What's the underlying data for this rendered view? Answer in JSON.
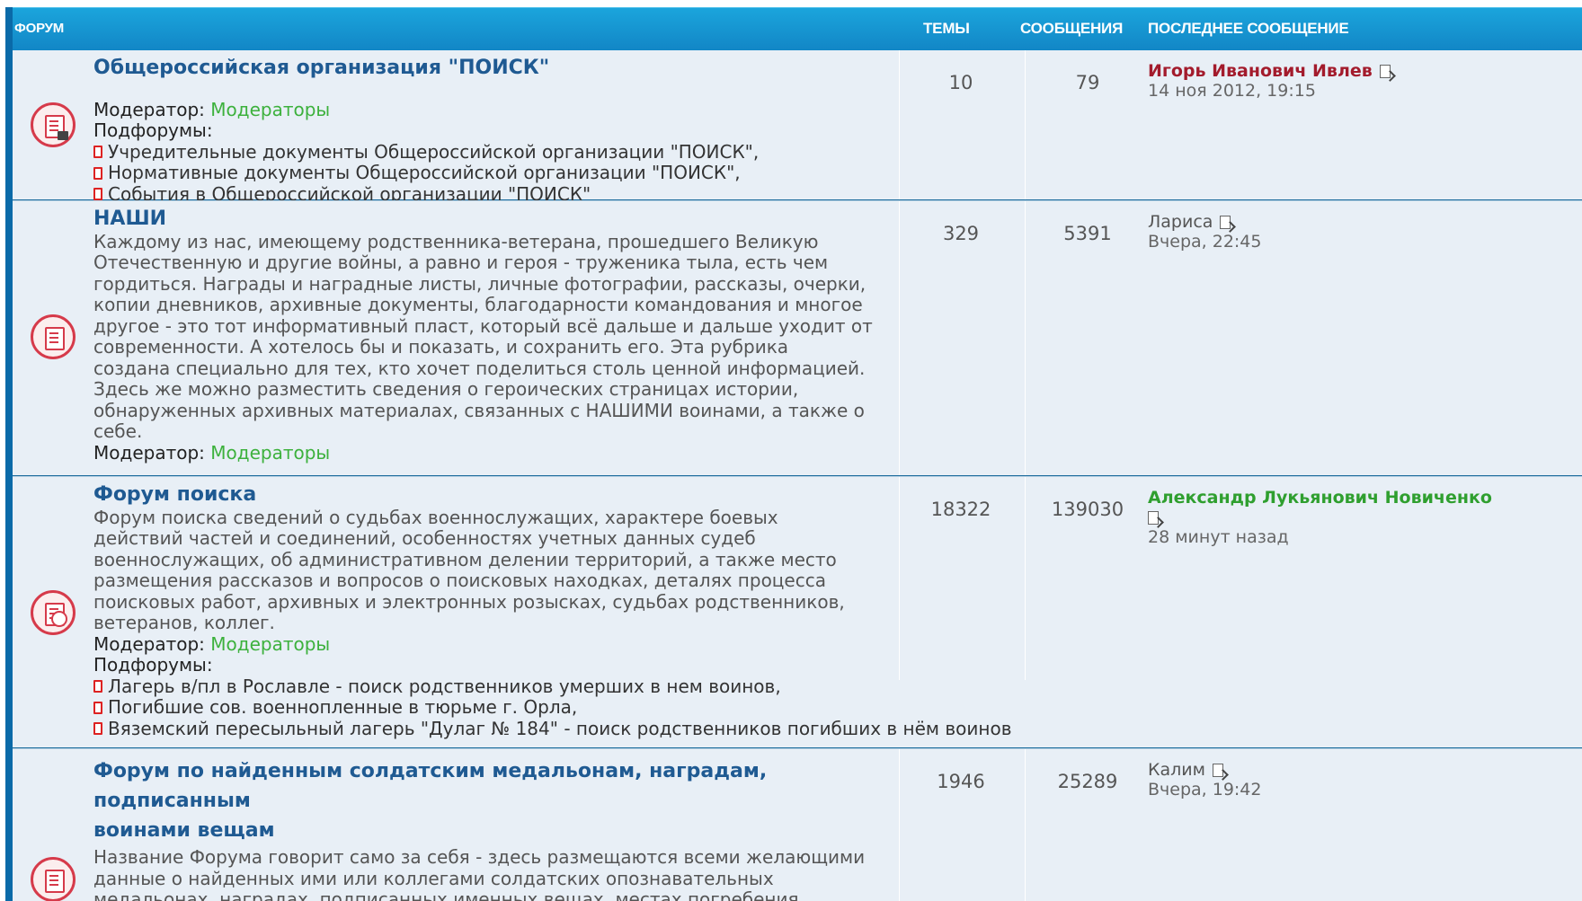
{
  "header": {
    "forum": "ФОРУМ",
    "topics": "ТЕМЫ",
    "posts": "СООБЩЕНИЯ",
    "last_post": "ПОСЛЕДНЕЕ СООБЩЕНИЕ"
  },
  "forums": [
    {
      "title": "Общероссийская организация \"ПОИСК\"",
      "moderator_label": "Модератор:",
      "moderator": "Модераторы",
      "subforums_label": "Подфорумы:",
      "subforums": [
        "Учредительные документы Общероссийской организации \"ПОИСК\",",
        "Нормативные документы Общероссийской организации \"ПОИСК\",",
        "События в Общероссийской организации \"ПОИСК\""
      ],
      "topics": "10",
      "posts": "79",
      "last_user": "Игорь Иванович Ивлев",
      "last_time": "14 ноя 2012, 19:15"
    },
    {
      "title": "НАШИ",
      "desc_lines": [
        "Каждому из нас, имеющему родственника-ветерана, прошедшего Великую",
        "Отечественную и другие войны, а равно и героя - труженика тыла, есть чем",
        "гордиться. Награды и наградные листы, личные фотографии, рассказы, очерки,",
        "копии дневников, архивные документы, благодарности командования и многое",
        "другое - это тот информативный пласт, который всё дальше и дальше уходит от",
        "современности. А хотелось бы и показать, и сохранить его. Эта рубрика",
        "создана специально для тех, кто хочет поделиться столь ценной информацией.",
        "Здесь же можно разместить сведения о героических страницах истории,",
        "обнаруженных архивных материалах, связанных с НАШИМИ воинами, а также о",
        "себе."
      ],
      "moderator_label": "Модератор:",
      "moderator": "Модераторы",
      "topics": "329",
      "posts": "5391",
      "last_user": "Лариса",
      "last_time": "Вчера, 22:45"
    },
    {
      "title": "Форум поиска",
      "desc_lines": [
        "Форум поиска сведений о судьбах военнослужащих, характере боевых",
        "действий частей и соединений, особенностях учетных данных судеб",
        "военнослужащих, об административном делении территорий, а также место",
        "размещения рассказов и вопросов о поисковых находках, деталях процесса",
        "поисковых работ, архивных и электронных розысках, судьбах родственников,",
        "ветеранов, коллег."
      ],
      "moderator_label": "Модератор:",
      "moderator": "Модераторы",
      "subforums_label": "Подфорумы:",
      "subforums": [
        "Лагерь в/пл в Рославле - поиск родственников умерших в нем воинов,",
        "Погибшие сов. военнопленные в тюрьме г. Орла,",
        "Вяземский пересыльный лагерь \"Дулаг № 184\" - поиск родственников погибших в нём воинов"
      ],
      "topics": "18322",
      "posts": "139030",
      "last_user": "Александр Лукьянович Новиченко",
      "last_time": "28 минут назад"
    },
    {
      "title_lines": [
        "Форум по найденным солдатским медальонам, наградам, подписанным",
        "воинами вещам"
      ],
      "desc_lines": [
        "Название Форума говорит само за себя - здесь размещаются всеми желающими",
        "данные о найденных ими или коллегами солдатских опознавательных",
        "медальонах, наградах, подписанных именных вещах, местах погребения"
      ],
      "topics": "1946",
      "posts": "25289",
      "last_user": "Калим",
      "last_time": "Вчера, 19:42"
    }
  ]
}
